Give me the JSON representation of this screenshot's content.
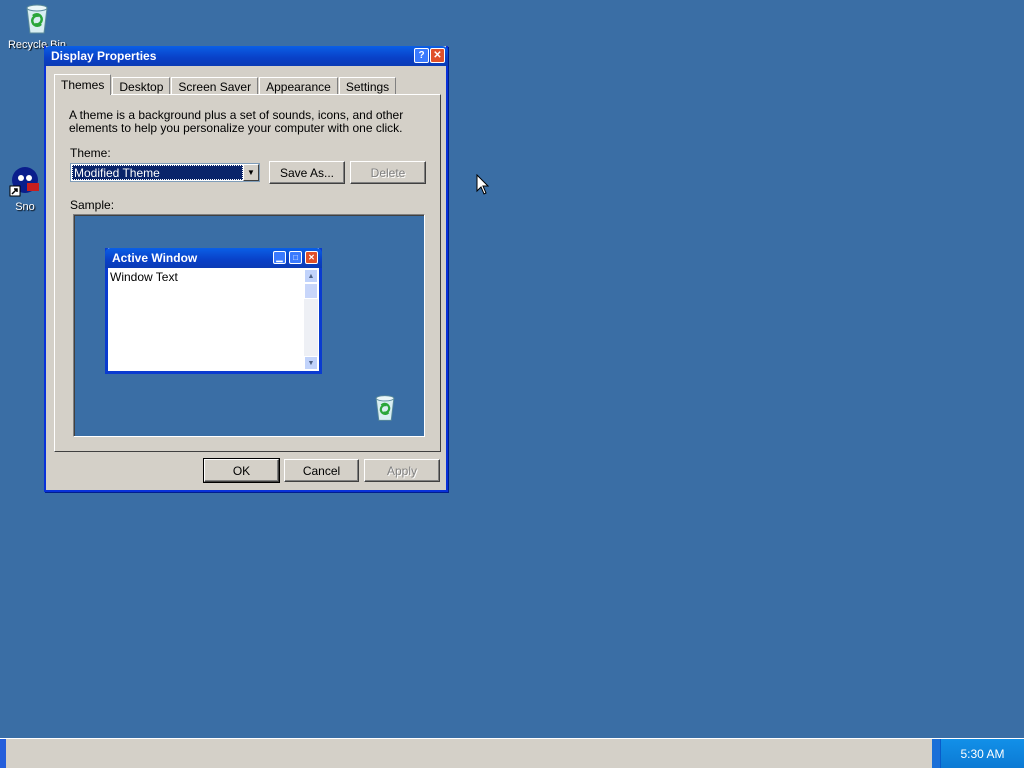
{
  "desktop": {
    "icons": [
      {
        "label": "Recycle Bin"
      },
      {
        "label": "Sno"
      }
    ]
  },
  "dialog": {
    "title": "Display Properties",
    "help_glyph": "?",
    "close_glyph": "✕",
    "tabs": [
      {
        "label": "Themes",
        "active": true
      },
      {
        "label": "Desktop"
      },
      {
        "label": "Screen Saver"
      },
      {
        "label": "Appearance"
      },
      {
        "label": "Settings"
      }
    ],
    "description": "A theme is a background plus a set of sounds, icons, and other elements to help you personalize your computer with one click.",
    "theme_label": "Theme:",
    "theme_value": "Modified Theme",
    "save_as_label": "Save As...",
    "delete_label": "Delete",
    "sample_label": "Sample:",
    "sample": {
      "window_title": "Active Window",
      "window_text": "Window Text"
    },
    "ok_label": "OK",
    "cancel_label": "Cancel",
    "apply_label": "Apply"
  },
  "taskbar": {
    "clock": "5:30 AM"
  },
  "colors": {
    "desktop": "#3a6ea5",
    "titlebar": "#0a5fe6",
    "dialog_face": "#d4d0c8",
    "selection": "#0a246a"
  }
}
